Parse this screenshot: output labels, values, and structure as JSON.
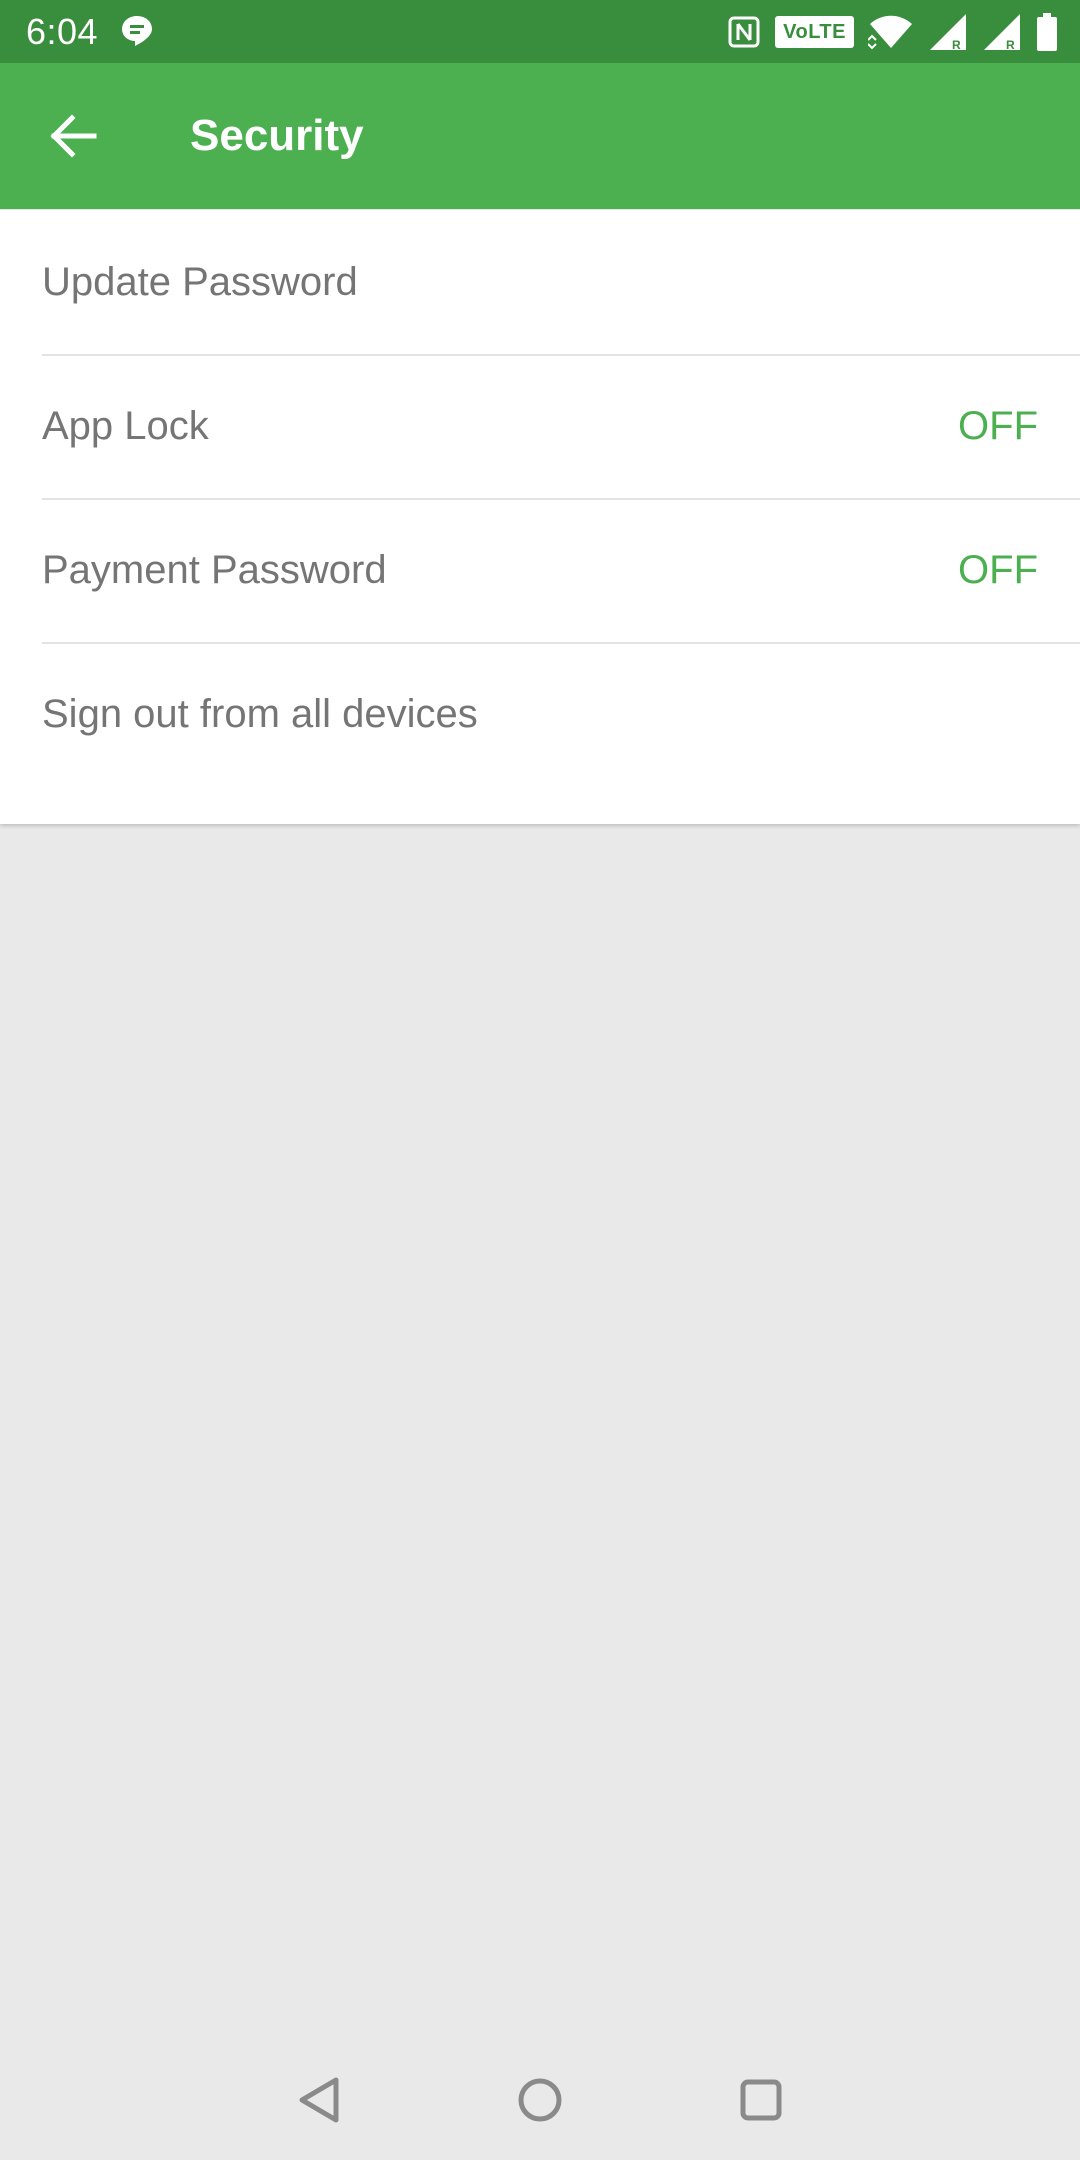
{
  "status_bar": {
    "time": "6:04",
    "network_badge": "VoLTE",
    "icons": [
      "chat-icon",
      "nfc-icon",
      "wifi-icon",
      "signal-icon",
      "signal-roaming-icon",
      "battery-icon"
    ]
  },
  "app_bar": {
    "title": "Security",
    "back_icon": "arrow-left-icon",
    "background_color": "#4caf50",
    "status_color": "#388e3c"
  },
  "settings": {
    "items": [
      {
        "label": "Update Password",
        "value": ""
      },
      {
        "label": "App Lock",
        "value": "OFF"
      },
      {
        "label": "Payment Password",
        "value": "OFF"
      },
      {
        "label": "Sign out from all devices",
        "value": ""
      }
    ],
    "value_color": "#4caf50",
    "label_color": "#757575"
  },
  "nav_bar": {
    "buttons": [
      "back-triangle-icon",
      "home-circle-icon",
      "recents-square-icon"
    ]
  }
}
